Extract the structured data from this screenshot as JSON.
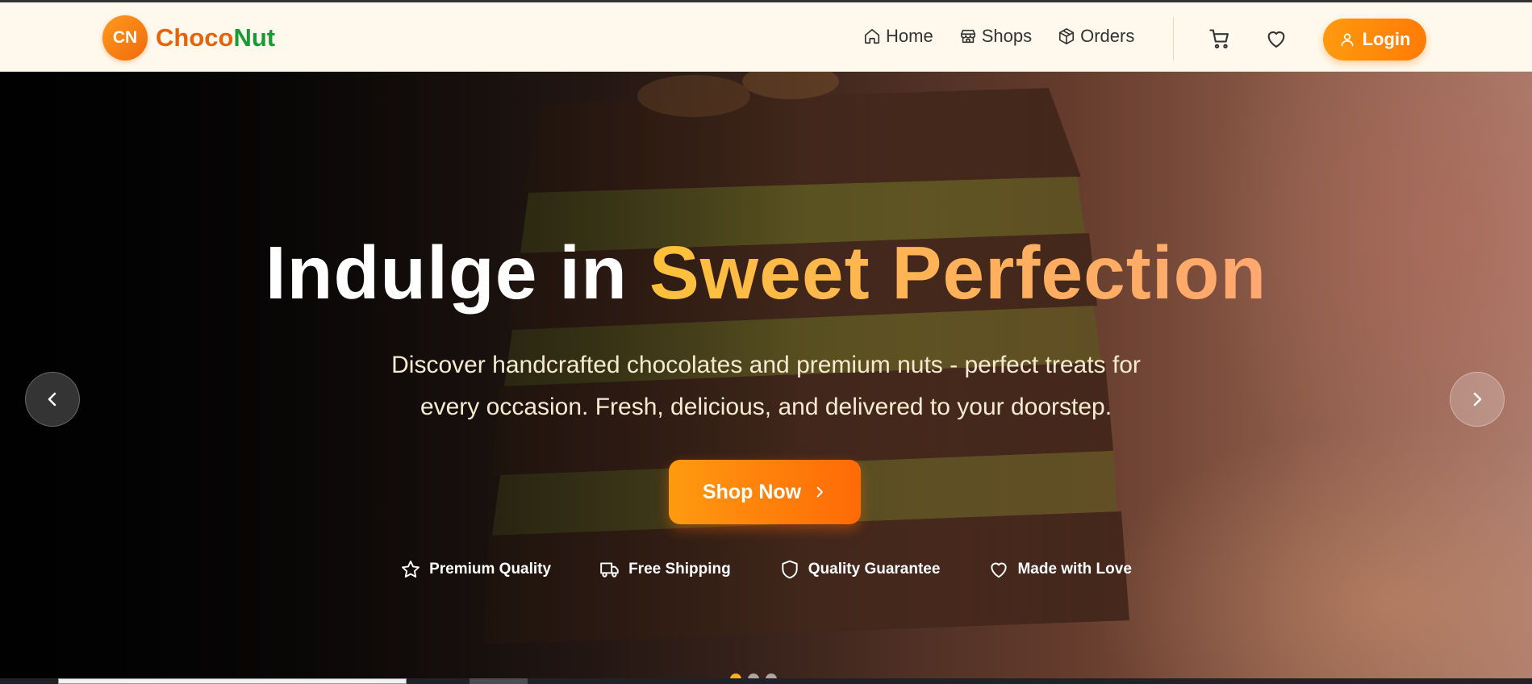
{
  "brand": {
    "badge": "CN",
    "name_part1": "Choco",
    "name_part2": "Nut",
    "colors": {
      "primary": "#ff8a0a",
      "choco": "#e2650c",
      "nut": "#1a9a36"
    }
  },
  "nav": {
    "items": [
      {
        "label": "Home",
        "icon": "home-icon"
      },
      {
        "label": "Shops",
        "icon": "store-icon"
      },
      {
        "label": "Orders",
        "icon": "package-icon"
      }
    ],
    "cart_icon": "cart-icon",
    "wishlist_icon": "heart-icon",
    "login_label": "Login",
    "login_icon": "user-icon"
  },
  "hero": {
    "title_plain": "Indulge in ",
    "title_accent": "Sweet Perfection",
    "subtitle_line1": "Discover handcrafted chocolates and premium nuts - perfect treats for",
    "subtitle_line2": "every occasion. Fresh, delicious, and delivered to your doorstep.",
    "cta_label": "Shop Now",
    "features": [
      {
        "label": "Premium Quality",
        "icon": "star-icon"
      },
      {
        "label": "Free Shipping",
        "icon": "truck-icon"
      },
      {
        "label": "Quality Guarantee",
        "icon": "shield-icon"
      },
      {
        "label": "Made with Love",
        "icon": "heart-icon"
      }
    ],
    "carousel": {
      "prev_icon": "chevron-left-icon",
      "next_icon": "chevron-right-icon",
      "active_slide": 1,
      "slides": 3
    }
  }
}
